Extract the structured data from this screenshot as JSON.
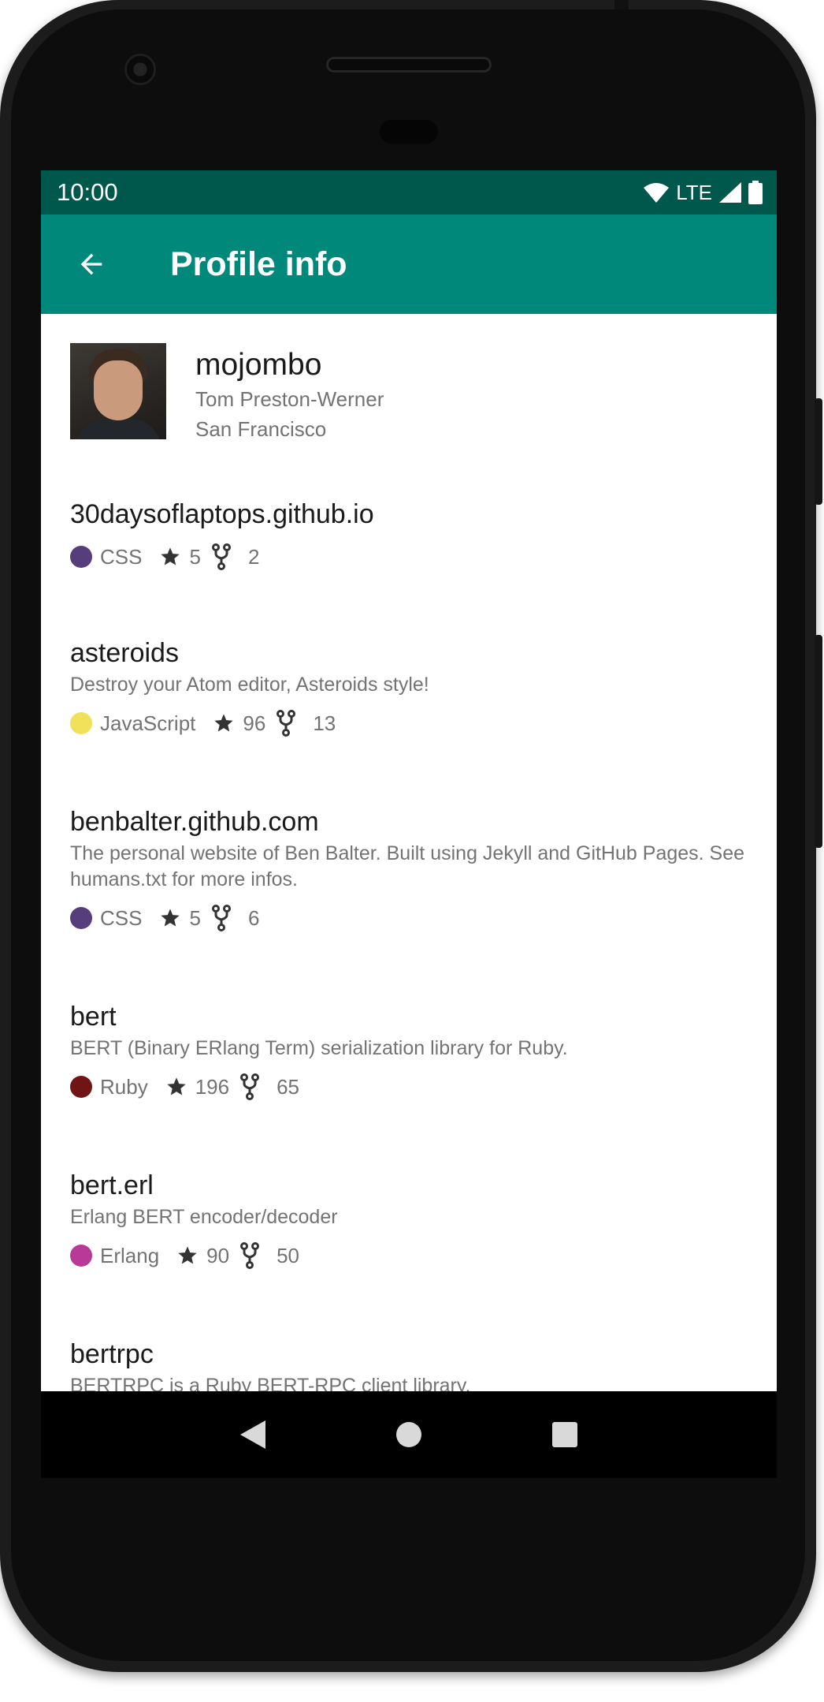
{
  "status_bar": {
    "time": "10:00",
    "network": "LTE",
    "icons": [
      "wifi-icon",
      "signal-icon",
      "battery-icon"
    ]
  },
  "app_bar": {
    "title": "Profile info",
    "back_icon": "arrow-back-icon"
  },
  "profile": {
    "username": "mojombo",
    "full_name": "Tom Preston-Werner",
    "location": "San Francisco"
  },
  "repositories": [
    {
      "name": "30daysoflaptops.github.io",
      "description": "",
      "language": "CSS",
      "language_color": "#563d7c",
      "stars": "5",
      "forks": "2"
    },
    {
      "name": "asteroids",
      "description": "Destroy your Atom editor, Asteroids style!",
      "language": "JavaScript",
      "language_color": "#f1e05a",
      "stars": "96",
      "forks": "13"
    },
    {
      "name": "benbalter.github.com",
      "description": "The personal website of Ben Balter. Built using Jekyll and GitHub Pages. See humans.txt for more infos.",
      "language": "CSS",
      "language_color": "#563d7c",
      "stars": "5",
      "forks": "6"
    },
    {
      "name": "bert",
      "description": "BERT (Binary ERlang Term) serialization library for Ruby.",
      "language": "Ruby",
      "language_color": "#701516",
      "stars": "196",
      "forks": "65"
    },
    {
      "name": "bert.erl",
      "description": "Erlang BERT encoder/decoder",
      "language": "Erlang",
      "language_color": "#b83998",
      "stars": "90",
      "forks": "50"
    },
    {
      "name": "bertrpc",
      "description": "BERTRPC is a Ruby BERT-RPC client library.",
      "language": "",
      "language_color": "",
      "stars": "",
      "forks": ""
    }
  ],
  "colors": {
    "primary": "#00897b",
    "primary_dark": "#00574b",
    "secondary_text": "#737373"
  },
  "nav": {
    "icons": [
      "nav-back-icon",
      "nav-home-icon",
      "nav-recents-icon"
    ]
  }
}
